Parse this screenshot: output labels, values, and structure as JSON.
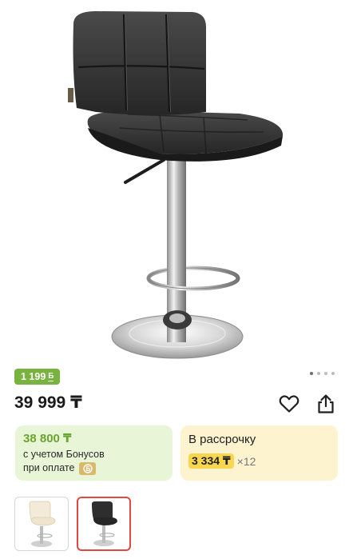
{
  "product": {
    "image_alt": "Барный стул",
    "gallery_pages": 4,
    "gallery_active_index": 0
  },
  "bonus_chip": {
    "amount": "1 199",
    "icon": "bonus-b-icon"
  },
  "price": {
    "value": "39 999 ₸"
  },
  "actions": {
    "favorite_icon": "heart-icon",
    "share_icon": "share-icon"
  },
  "bonus_card": {
    "price": "38 800 ₸",
    "line1": "с учетом Бонусов",
    "line2": "при оплате"
  },
  "installment_card": {
    "title": "В рассрочку",
    "amount": "3 334 ₸",
    "multiplier": "×12"
  },
  "colors": {
    "accent_green": "#79b33f",
    "bonus_bg": "#e8f5d7",
    "install_bg": "#fdf3cf",
    "install_highlight": "#f8d64e",
    "selected_border": "#e1483f"
  },
  "thumbnails": [
    {
      "variant": "white",
      "selected": false
    },
    {
      "variant": "black",
      "selected": true
    }
  ]
}
